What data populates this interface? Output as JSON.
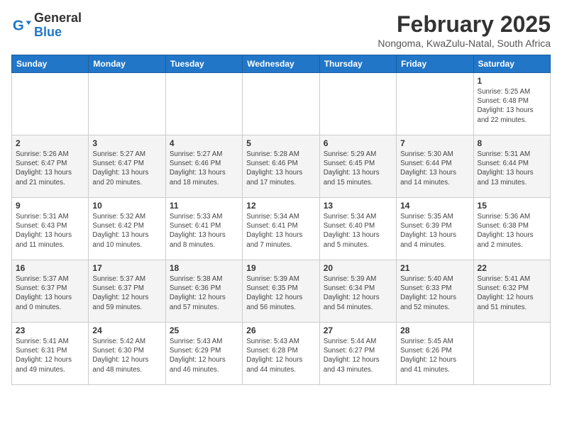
{
  "logo": {
    "general": "General",
    "blue": "Blue"
  },
  "title": "February 2025",
  "subtitle": "Nongoma, KwaZulu-Natal, South Africa",
  "headers": [
    "Sunday",
    "Monday",
    "Tuesday",
    "Wednesday",
    "Thursday",
    "Friday",
    "Saturday"
  ],
  "weeks": [
    [
      {
        "day": "",
        "info": ""
      },
      {
        "day": "",
        "info": ""
      },
      {
        "day": "",
        "info": ""
      },
      {
        "day": "",
        "info": ""
      },
      {
        "day": "",
        "info": ""
      },
      {
        "day": "",
        "info": ""
      },
      {
        "day": "1",
        "info": "Sunrise: 5:25 AM\nSunset: 6:48 PM\nDaylight: 13 hours\nand 22 minutes."
      }
    ],
    [
      {
        "day": "2",
        "info": "Sunrise: 5:26 AM\nSunset: 6:47 PM\nDaylight: 13 hours\nand 21 minutes."
      },
      {
        "day": "3",
        "info": "Sunrise: 5:27 AM\nSunset: 6:47 PM\nDaylight: 13 hours\nand 20 minutes."
      },
      {
        "day": "4",
        "info": "Sunrise: 5:27 AM\nSunset: 6:46 PM\nDaylight: 13 hours\nand 18 minutes."
      },
      {
        "day": "5",
        "info": "Sunrise: 5:28 AM\nSunset: 6:46 PM\nDaylight: 13 hours\nand 17 minutes."
      },
      {
        "day": "6",
        "info": "Sunrise: 5:29 AM\nSunset: 6:45 PM\nDaylight: 13 hours\nand 15 minutes."
      },
      {
        "day": "7",
        "info": "Sunrise: 5:30 AM\nSunset: 6:44 PM\nDaylight: 13 hours\nand 14 minutes."
      },
      {
        "day": "8",
        "info": "Sunrise: 5:31 AM\nSunset: 6:44 PM\nDaylight: 13 hours\nand 13 minutes."
      }
    ],
    [
      {
        "day": "9",
        "info": "Sunrise: 5:31 AM\nSunset: 6:43 PM\nDaylight: 13 hours\nand 11 minutes."
      },
      {
        "day": "10",
        "info": "Sunrise: 5:32 AM\nSunset: 6:42 PM\nDaylight: 13 hours\nand 10 minutes."
      },
      {
        "day": "11",
        "info": "Sunrise: 5:33 AM\nSunset: 6:41 PM\nDaylight: 13 hours\nand 8 minutes."
      },
      {
        "day": "12",
        "info": "Sunrise: 5:34 AM\nSunset: 6:41 PM\nDaylight: 13 hours\nand 7 minutes."
      },
      {
        "day": "13",
        "info": "Sunrise: 5:34 AM\nSunset: 6:40 PM\nDaylight: 13 hours\nand 5 minutes."
      },
      {
        "day": "14",
        "info": "Sunrise: 5:35 AM\nSunset: 6:39 PM\nDaylight: 13 hours\nand 4 minutes."
      },
      {
        "day": "15",
        "info": "Sunrise: 5:36 AM\nSunset: 6:38 PM\nDaylight: 13 hours\nand 2 minutes."
      }
    ],
    [
      {
        "day": "16",
        "info": "Sunrise: 5:37 AM\nSunset: 6:37 PM\nDaylight: 13 hours\nand 0 minutes."
      },
      {
        "day": "17",
        "info": "Sunrise: 5:37 AM\nSunset: 6:37 PM\nDaylight: 12 hours\nand 59 minutes."
      },
      {
        "day": "18",
        "info": "Sunrise: 5:38 AM\nSunset: 6:36 PM\nDaylight: 12 hours\nand 57 minutes."
      },
      {
        "day": "19",
        "info": "Sunrise: 5:39 AM\nSunset: 6:35 PM\nDaylight: 12 hours\nand 56 minutes."
      },
      {
        "day": "20",
        "info": "Sunrise: 5:39 AM\nSunset: 6:34 PM\nDaylight: 12 hours\nand 54 minutes."
      },
      {
        "day": "21",
        "info": "Sunrise: 5:40 AM\nSunset: 6:33 PM\nDaylight: 12 hours\nand 52 minutes."
      },
      {
        "day": "22",
        "info": "Sunrise: 5:41 AM\nSunset: 6:32 PM\nDaylight: 12 hours\nand 51 minutes."
      }
    ],
    [
      {
        "day": "23",
        "info": "Sunrise: 5:41 AM\nSunset: 6:31 PM\nDaylight: 12 hours\nand 49 minutes."
      },
      {
        "day": "24",
        "info": "Sunrise: 5:42 AM\nSunset: 6:30 PM\nDaylight: 12 hours\nand 48 minutes."
      },
      {
        "day": "25",
        "info": "Sunrise: 5:43 AM\nSunset: 6:29 PM\nDaylight: 12 hours\nand 46 minutes."
      },
      {
        "day": "26",
        "info": "Sunrise: 5:43 AM\nSunset: 6:28 PM\nDaylight: 12 hours\nand 44 minutes."
      },
      {
        "day": "27",
        "info": "Sunrise: 5:44 AM\nSunset: 6:27 PM\nDaylight: 12 hours\nand 43 minutes."
      },
      {
        "day": "28",
        "info": "Sunrise: 5:45 AM\nSunset: 6:26 PM\nDaylight: 12 hours\nand 41 minutes."
      },
      {
        "day": "",
        "info": ""
      }
    ]
  ]
}
